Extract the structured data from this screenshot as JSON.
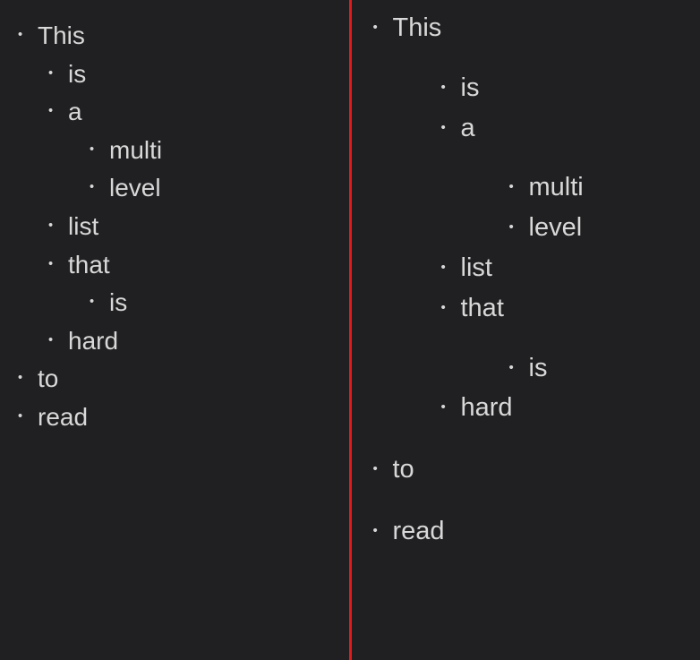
{
  "divider_color": "#e11b1b",
  "left": {
    "items": [
      {
        "text": "This",
        "children": [
          {
            "text": "is"
          },
          {
            "text": "a",
            "children": [
              {
                "text": "multi"
              },
              {
                "text": "level"
              }
            ]
          },
          {
            "text": "list"
          },
          {
            "text": "that",
            "children": [
              {
                "text": "is"
              }
            ]
          },
          {
            "text": "hard"
          }
        ]
      },
      {
        "text": "to"
      },
      {
        "text": "read"
      }
    ]
  },
  "right": {
    "items": [
      {
        "text": "This",
        "children": [
          {
            "text": "is"
          },
          {
            "text": "a",
            "children": [
              {
                "text": "multi"
              },
              {
                "text": "level"
              }
            ]
          },
          {
            "text": "list"
          },
          {
            "text": "that",
            "children": [
              {
                "text": "is"
              }
            ]
          },
          {
            "text": "hard"
          }
        ]
      },
      {
        "text": "to"
      },
      {
        "text": "read"
      }
    ]
  }
}
